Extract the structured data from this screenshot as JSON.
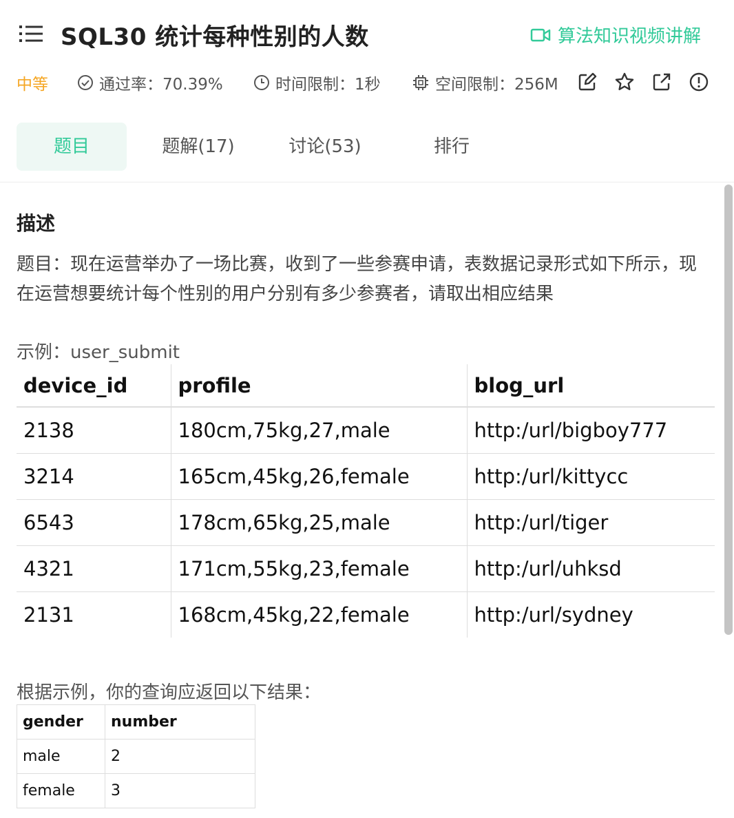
{
  "header": {
    "title": "SQL30  统计每种性别的人数",
    "video_link": "算法知识视频讲解"
  },
  "meta": {
    "difficulty": "中等",
    "pass_rate": "通过率：70.39%",
    "time_limit": "时间限制：1秒",
    "space_limit": "空间限制：256M"
  },
  "tabs": [
    {
      "label": "题目"
    },
    {
      "label": "题解(17)"
    },
    {
      "label": "讨论(53)"
    },
    {
      "label": "排行"
    }
  ],
  "content": {
    "section_title": "描述",
    "description": "题目：现在运营举办了一场比赛，收到了一些参赛申请，表数据记录形式如下所示，现在运营想要统计每个性别的用户分别有多少参赛者，请取出相应结果",
    "example_label": "示例：user_submit",
    "table1": {
      "headers": [
        "device_id",
        "profile",
        "blog_url"
      ],
      "rows": [
        [
          "2138",
          "180cm,75kg,27,male",
          "http:/url/bigboy777"
        ],
        [
          "3214",
          "165cm,45kg,26,female",
          "http:/url/kittycc"
        ],
        [
          "6543",
          "178cm,65kg,25,male",
          "http:/url/tiger"
        ],
        [
          "4321",
          "171cm,55kg,23,female",
          "http:/url/uhksd"
        ],
        [
          "2131",
          "168cm,45kg,22,female",
          "http:/url/sydney"
        ]
      ]
    },
    "result_label": "根据示例，你的查询应返回以下结果：",
    "table2": {
      "headers": [
        "gender",
        "number"
      ],
      "rows": [
        [
          "male",
          "2"
        ],
        [
          "female",
          "3"
        ]
      ]
    }
  },
  "colors": {
    "accent": "#32ca99",
    "difficulty": "#f5a623",
    "active_tab_bg": "#eef8f4"
  },
  "icons": {
    "menu": "list-icon",
    "video": "video-camera-icon",
    "pass_rate": "check-circle-icon",
    "time": "clock-icon",
    "space": "chip-icon",
    "edit": "edit-icon",
    "favorite": "star-icon",
    "share": "external-link-icon",
    "report": "alert-circle-icon"
  }
}
